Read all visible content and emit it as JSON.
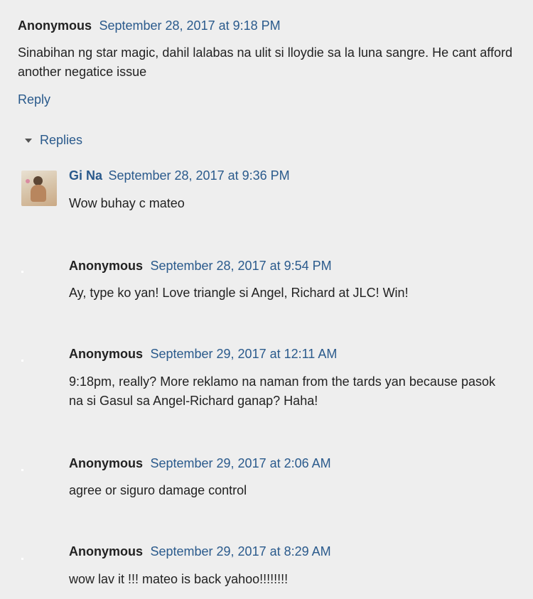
{
  "comment": {
    "author": "Anonymous",
    "date": "September 28, 2017 at 9:18 PM",
    "text": "Sinabihan ng star magic, dahil lalabas na ulit si lloydie sa la luna sangre. He cant afford another negatice issue",
    "reply_label": "Reply"
  },
  "replies_toggle": "Replies",
  "replies": [
    {
      "author": "Gi Na",
      "date": "September 28, 2017 at 9:36 PM",
      "text": "Wow buhay c mateo"
    },
    {
      "author": "Anonymous",
      "date": "September 28, 2017 at 9:54 PM",
      "text": "Ay, type ko yan! Love triangle si Angel, Richard at JLC! Win!"
    },
    {
      "author": "Anonymous",
      "date": "September 29, 2017 at 12:11 AM",
      "text": "9:18pm, really? More reklamo na naman from the tards yan because pasok na si Gasul sa Angel-Richard ganap? Haha!"
    },
    {
      "author": "Anonymous",
      "date": "September 29, 2017 at 2:06 AM",
      "text": "agree or siguro damage control"
    },
    {
      "author": "Anonymous",
      "date": "September 29, 2017 at 8:29 AM",
      "text": "wow lav it !!! mateo is back yahoo!!!!!!!!"
    }
  ],
  "icons": {
    "replies_toggle": "caret-down-icon",
    "avatar": "user-avatar-photo",
    "blank_avatar": "blank-avatar-icon"
  },
  "colors": {
    "background": "#eeeeee",
    "link": "#2a5a8c",
    "text": "#222222"
  }
}
